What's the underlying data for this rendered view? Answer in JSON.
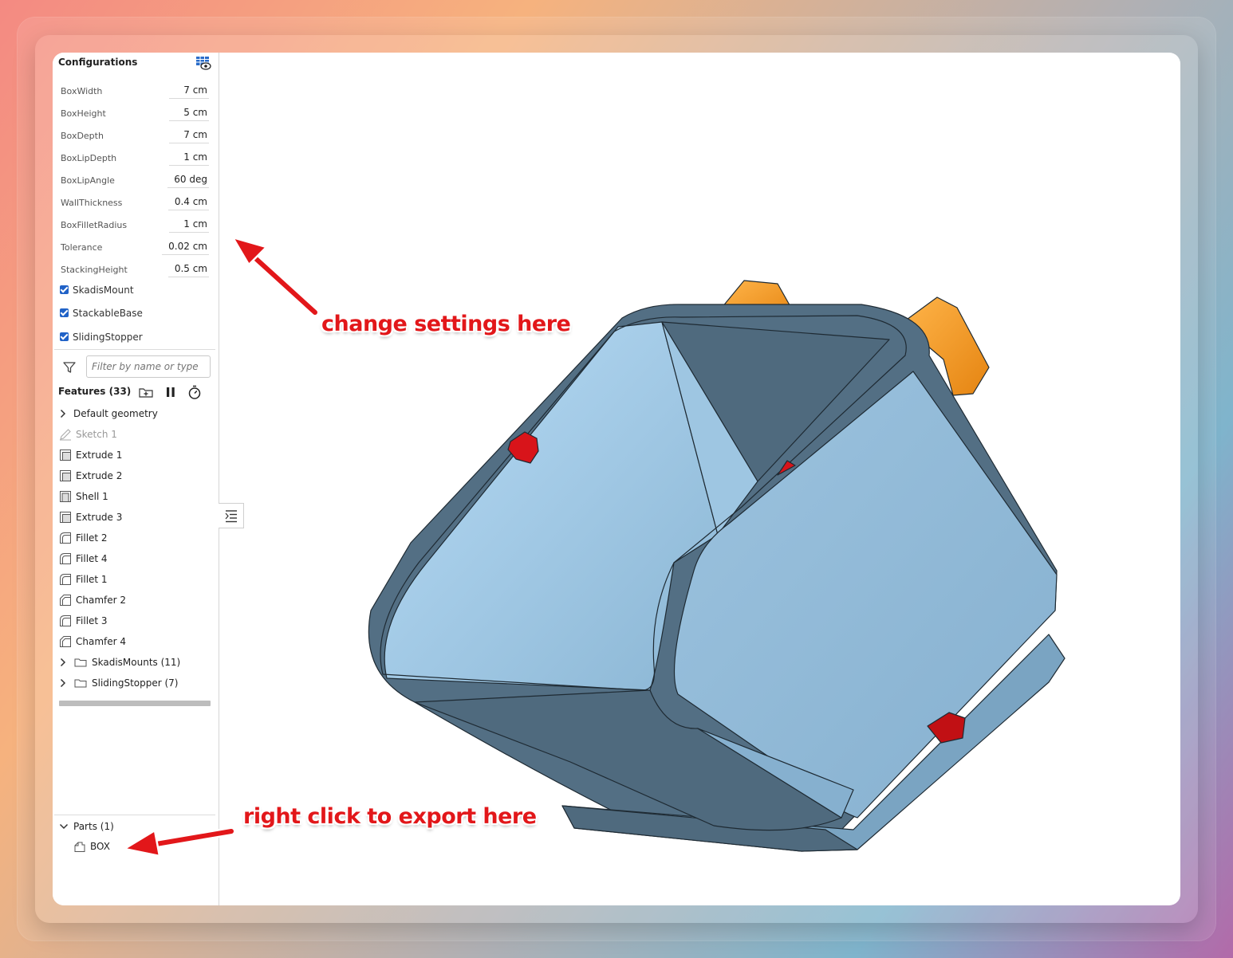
{
  "configurations": {
    "title": "Configurations",
    "params": [
      {
        "name": "BoxWidth",
        "value": "7 cm"
      },
      {
        "name": "BoxHeight",
        "value": "5 cm"
      },
      {
        "name": "BoxDepth",
        "value": "7 cm"
      },
      {
        "name": "BoxLipDepth",
        "value": "1 cm"
      },
      {
        "name": "BoxLipAngle",
        "value": "60 deg"
      },
      {
        "name": "WallThickness",
        "value": "0.4 cm"
      },
      {
        "name": "BoxFilletRadius",
        "value": "1 cm"
      },
      {
        "name": "Tolerance",
        "value": "0.02 cm"
      },
      {
        "name": "StackingHeight",
        "value": "0.5 cm"
      }
    ],
    "toggles": [
      {
        "name": "SkadisMount",
        "checked": true
      },
      {
        "name": "StackableBase",
        "checked": true
      },
      {
        "name": "SlidingStopper",
        "checked": true
      }
    ]
  },
  "filter": {
    "placeholder": "Filter by name or type"
  },
  "features": {
    "header": "Features (33)",
    "items": [
      {
        "label": "Default geometry",
        "icon": "chevron-right-icon"
      },
      {
        "label": "Sketch 1",
        "icon": "sketch-icon"
      },
      {
        "label": "Extrude 1",
        "icon": "extrude-icon"
      },
      {
        "label": "Extrude 2",
        "icon": "extrude-icon"
      },
      {
        "label": "Shell 1",
        "icon": "shell-icon"
      },
      {
        "label": "Extrude 3",
        "icon": "extrude-icon"
      },
      {
        "label": "Fillet 2",
        "icon": "fillet-icon"
      },
      {
        "label": "Fillet 4",
        "icon": "fillet-icon"
      },
      {
        "label": "Fillet 1",
        "icon": "fillet-icon"
      },
      {
        "label": "Chamfer 2",
        "icon": "chamfer-icon"
      },
      {
        "label": "Fillet 3",
        "icon": "fillet-icon"
      },
      {
        "label": "Chamfer 4",
        "icon": "chamfer-icon"
      },
      {
        "label": "SkadisMounts (11)",
        "icon": "folder-icon"
      },
      {
        "label": "SlidingStopper (7)",
        "icon": "folder-icon"
      }
    ]
  },
  "parts": {
    "header": "Parts (1)",
    "items": [
      {
        "label": "BOX",
        "icon": "part-icon"
      }
    ]
  },
  "annotations": {
    "settings": "change settings here",
    "export": "right click to export here"
  },
  "colors": {
    "box_face": "#92bcda",
    "box_dark": "#506b80",
    "mount": "#f39a1f",
    "stopper": "#d8141a",
    "annotation": "#e2171a",
    "checkbox": "#2062c7"
  }
}
